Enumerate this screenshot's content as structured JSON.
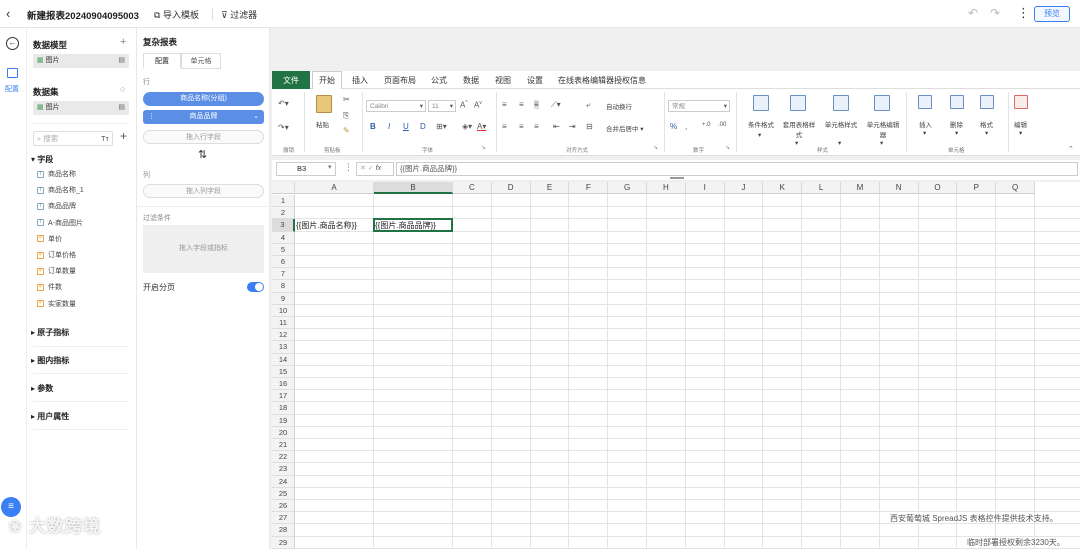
{
  "topbar": {
    "title": "新建报表20240904095003",
    "import_template": "导入模板",
    "filter": "过滤器",
    "preview": "预览"
  },
  "rail": {
    "config_label": "配置"
  },
  "model_panel": {
    "data_model_title": "数据模型",
    "data_model_item": "图片",
    "dataset_title": "数据集",
    "dataset_item": "图片",
    "search_placeholder": "搜索",
    "fields_group": "字段",
    "fields": [
      {
        "name": "商品名称",
        "type": "text"
      },
      {
        "name": "商品名称_1",
        "type": "text"
      },
      {
        "name": "商品品牌",
        "type": "text"
      },
      {
        "name": "A-商品图片",
        "type": "text"
      },
      {
        "name": "单价",
        "type": "number"
      },
      {
        "name": "订单价格",
        "type": "number"
      },
      {
        "name": "订单数量",
        "type": "number"
      },
      {
        "name": "件数",
        "type": "number"
      },
      {
        "name": "实家数量",
        "type": "number"
      }
    ],
    "groups": [
      "原子指标",
      "图内指标",
      "参数",
      "用户属性"
    ]
  },
  "config_panel": {
    "title": "复杂报表",
    "tabs": [
      "配置",
      "单元格"
    ],
    "row_label": "行",
    "row_pills": [
      "商品名称(分组)",
      "商品品牌"
    ],
    "row_drop": "拖入行字段",
    "col_label": "列",
    "col_drop": "拖入列字段",
    "filter_label": "过滤条件",
    "filter_drop": "拖入字段或指标",
    "paging_label": "开启分页",
    "paging_on": true
  },
  "ribbon": {
    "tabs": [
      "文件",
      "开始",
      "插入",
      "页面布局",
      "公式",
      "数据",
      "视图",
      "设置",
      "在线表格编辑器授权信息"
    ],
    "active_tab": "开始",
    "font_name": "Calibri",
    "font_size": "11",
    "paste": "粘贴",
    "wrap_text": "自动换行",
    "merge_center": "合并后居中",
    "number_format": "常规",
    "cond_format": "条件格式",
    "table_format": "套用表格样式",
    "cell_style": "单元格样式",
    "cell_editor": "单元格编辑器",
    "insert": "插入",
    "delete": "删除",
    "format": "格式",
    "edit": "编辑",
    "groups": [
      "撤销",
      "剪贴板",
      "字体",
      "对齐方式",
      "数字",
      "样式",
      "单元格"
    ]
  },
  "formula_bar": {
    "cell_ref": "B3",
    "formula": "{{图片.商品品牌}}"
  },
  "grid": {
    "columns": [
      "A",
      "B",
      "C",
      "D",
      "E",
      "F",
      "G",
      "H",
      "I",
      "J",
      "K",
      "L",
      "M",
      "N",
      "O",
      "P",
      "Q"
    ],
    "rows": [
      "1",
      "2",
      "3",
      "4",
      "5",
      "6",
      "7",
      "8",
      "9",
      "10",
      "11",
      "12",
      "13",
      "14",
      "15",
      "16",
      "17",
      "18",
      "19",
      "20",
      "21",
      "22",
      "23",
      "24",
      "25",
      "26",
      "27",
      "28",
      "29"
    ],
    "selected_col": "B",
    "selected_row": "3",
    "cells": {
      "A3": "{{图片.商品名称}}",
      "B3": "{{图片.商品品牌}}"
    }
  },
  "footer": {
    "support_text": "西安葡萄城 SpreadJS 表格控件提供技术支持。",
    "license_text": "临时部署授权剩余3230天。",
    "watermark": "大数跨境"
  }
}
